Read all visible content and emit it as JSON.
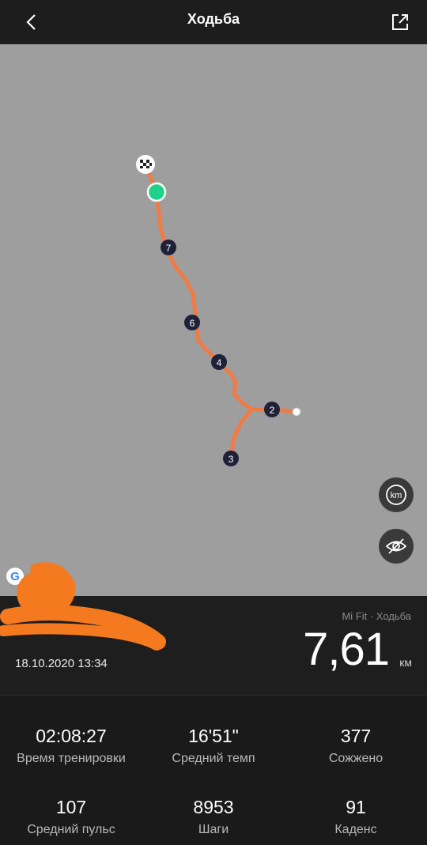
{
  "header": {
    "title": "Ходьба"
  },
  "map": {
    "markers": [
      "7",
      "6",
      "4",
      "2",
      "3"
    ],
    "start_icon": "checkered-flag-icon",
    "finish_icon": "green-dot-icon",
    "route_color": "#f07b45",
    "buttons": {
      "km_label": "km"
    },
    "google_logo": "G"
  },
  "summary": {
    "source": "Mi Fit · Ходьба",
    "distance": "7,61",
    "unit": "км",
    "date": "18.10.2020 13:34"
  },
  "stats": [
    {
      "value": "02:08:27",
      "label": "Время тренировки"
    },
    {
      "value": "16'51\"",
      "label": "Средний темп"
    },
    {
      "value": "377",
      "label": "Сожжено"
    },
    {
      "value": "107",
      "label": "Средний пульс"
    },
    {
      "value": "8953",
      "label": "Шаги"
    },
    {
      "value": "91",
      "label": "Каденс"
    }
  ]
}
